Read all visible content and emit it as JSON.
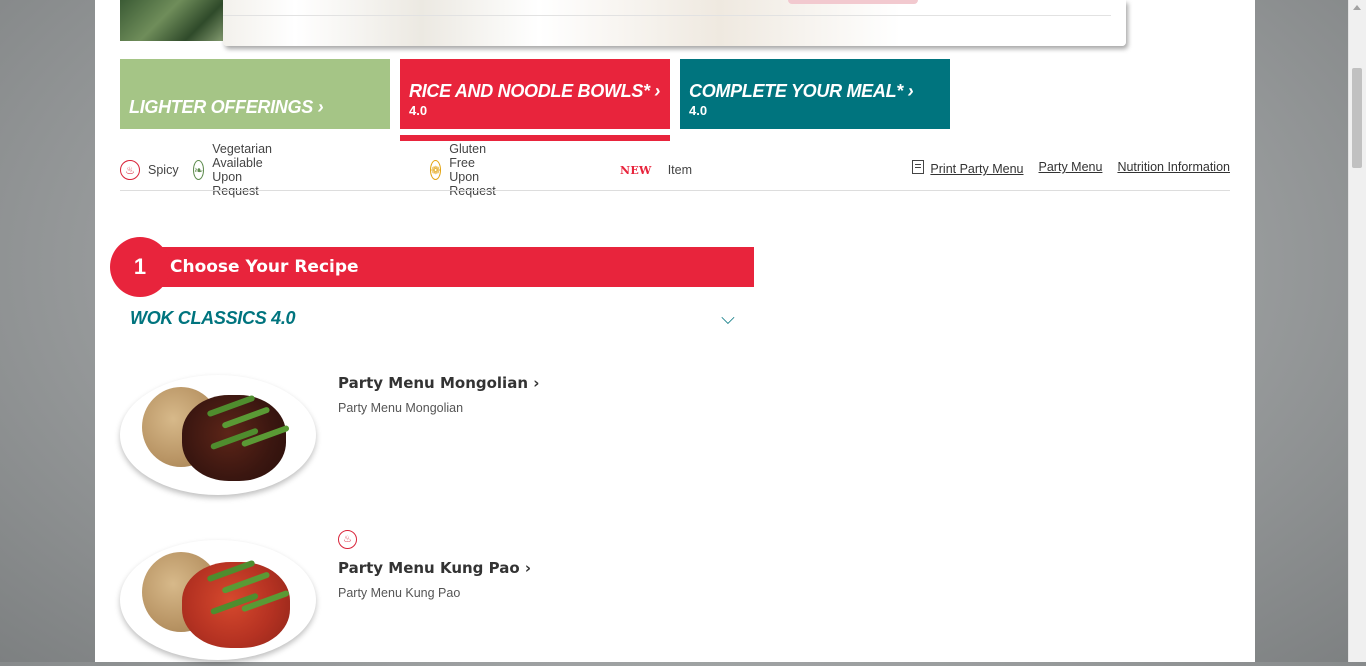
{
  "tiles": [
    {
      "label": "LIGHTER OFFERINGS ›",
      "version": ""
    },
    {
      "label": "RICE AND NOODLE BOWLS* ›",
      "version": "4.0"
    },
    {
      "label": "COMPLETE YOUR MEAL* ›",
      "version": "4.0"
    }
  ],
  "legend": {
    "spicy": "Spicy",
    "vegetarian": "Vegetarian Available Upon Request",
    "gluten_free": "Gluten Free Upon Request",
    "new_tag": "NEW",
    "item": "Item"
  },
  "links": {
    "print": "Print Party Menu",
    "party_menu": "Party Menu",
    "nutrition": "Nutrition Information"
  },
  "section": {
    "number": "1",
    "title": "Choose Your Recipe"
  },
  "subcategory": {
    "title": "WOK CLASSICS 4.0",
    "chevron": "⌵"
  },
  "items": [
    {
      "name": "Party Menu Mongolian ›",
      "description": "Party Menu Mongolian"
    },
    {
      "name": "Party Menu Kung Pao ›",
      "description": "Party Menu Kung Pao"
    }
  ],
  "icons": {
    "spicy": "spicy-icon",
    "vegetarian": "leaf-icon",
    "gluten_free": "wheat-icon",
    "print": "print-icon",
    "chevron": "chevron-down-icon"
  },
  "colors": {
    "brand_red": "#e8243c",
    "teal": "#00747e",
    "green": "#a5c586"
  }
}
